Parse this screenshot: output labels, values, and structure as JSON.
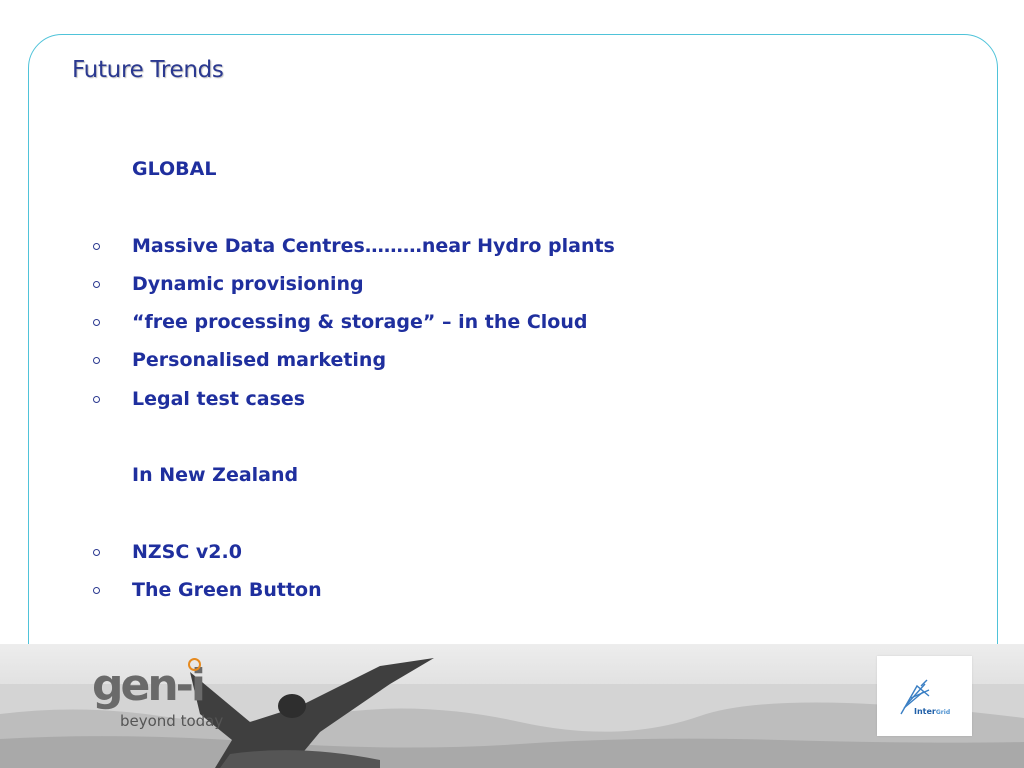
{
  "slide": {
    "title": "Future Trends",
    "lines": [
      {
        "text": "GLOBAL",
        "bullet": false
      },
      {
        "text": "",
        "bullet": false
      },
      {
        "text": "Massive Data Centres………near Hydro plants",
        "bullet": true
      },
      {
        "text": "Dynamic provisioning",
        "bullet": true
      },
      {
        "text": "“free processing & storage” – in the Cloud",
        "bullet": true
      },
      {
        "text": "Personalised marketing",
        "bullet": true
      },
      {
        "text": "Legal test cases",
        "bullet": true
      },
      {
        "text": "",
        "bullet": false
      },
      {
        "text": "In New Zealand",
        "bullet": false
      },
      {
        "text": "",
        "bullet": false
      },
      {
        "text": "NZSC v2.0",
        "bullet": true
      },
      {
        "text": "The Green Button",
        "bullet": true
      }
    ]
  },
  "footer": {
    "brand_logo": {
      "word": "gen-i",
      "tagline": "beyond today"
    },
    "partner_logo": {
      "name_main": "Inter",
      "name_small": "Grid"
    }
  },
  "colors": {
    "title": "#2b3990",
    "body_text": "#1f2f9e",
    "frame_border": "#4fc3d9",
    "brand_accent": "#e68a1f"
  }
}
